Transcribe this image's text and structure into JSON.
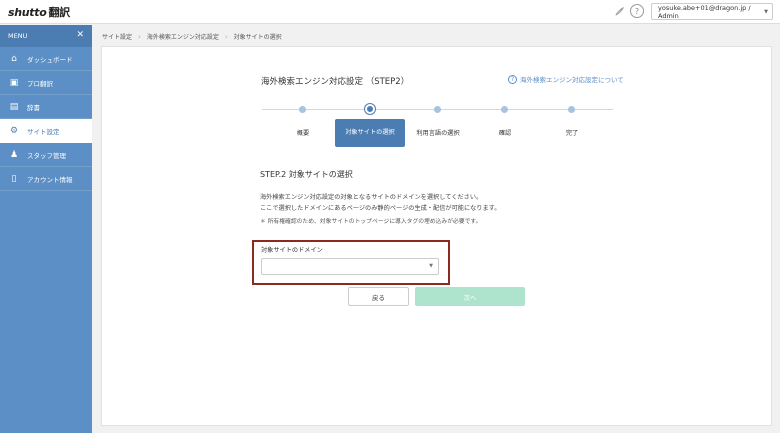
{
  "header": {
    "logo_brand": "shutto",
    "logo_product": "翻訳",
    "user": "yosuke.abe+01@dragon.jp / Admin"
  },
  "sidebar": {
    "menu_label": "MENU",
    "items": [
      {
        "label": "ダッシュボード",
        "icon": "dashboard-icon"
      },
      {
        "label": "プロ翻訳",
        "icon": "pro-translation-icon"
      },
      {
        "label": "辞書",
        "icon": "dictionary-icon"
      },
      {
        "label": "サイト設定",
        "icon": "gear-icon",
        "active": true
      },
      {
        "label": "スタッフ管理",
        "icon": "staff-icon"
      },
      {
        "label": "アカウント情報",
        "icon": "account-icon"
      }
    ]
  },
  "breadcrumb": [
    "サイト設定",
    "海外検索エンジン対応設定",
    "対象サイトの選択"
  ],
  "main": {
    "title": "海外検索エンジン対応設定 （STEP2）",
    "help_link": "海外検索エンジン対応設定について",
    "steps": [
      "概要",
      "対象サイトの選択",
      "利用言語の選択",
      "確認",
      "完了"
    ],
    "current_step": 1,
    "section_title": "STEP.2 対象サイトの選択",
    "desc_line1": "海外検索エンジン対応設定の対象となるサイトのドメインを選択してください。",
    "desc_line2": "ここで選択したドメインにあるページのみ静的ページの生成・配信が可能になります。",
    "note": "＊ 所有権確認のため、対象サイトのトップページに導入タグの埋め込みが必要です。",
    "field_label": "対象サイトのドメイン",
    "select_value": "",
    "back_label": "戻る",
    "next_label": "次へ"
  },
  "colors": {
    "sidebar": "#5b8fc5",
    "accent": "#4c7db2",
    "next_button": "#aee3cd",
    "highlight": "#8b2b1f"
  }
}
